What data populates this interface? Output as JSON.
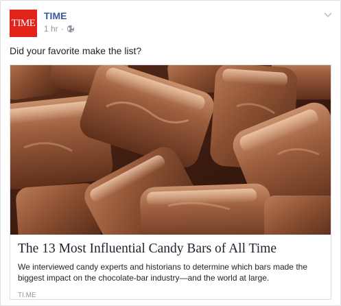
{
  "page": {
    "name": "TIME",
    "logo_text": "TIME",
    "timestamp": "1 hr",
    "separator": "·",
    "audience_icon": "globe-icon",
    "menu_icon": "chevron-down-icon",
    "brand_color": "#e2231a"
  },
  "post": {
    "text": "Did your favorite make the list?"
  },
  "link": {
    "image": "chocolate-candy-bars-photo",
    "title": "The 13 Most Influential Candy Bars of All Time",
    "description": "We interviewed candy experts and historians to determine which bars made the biggest impact on the chocolate-bar industry—and the world at large.",
    "domain": "TI.ME"
  }
}
